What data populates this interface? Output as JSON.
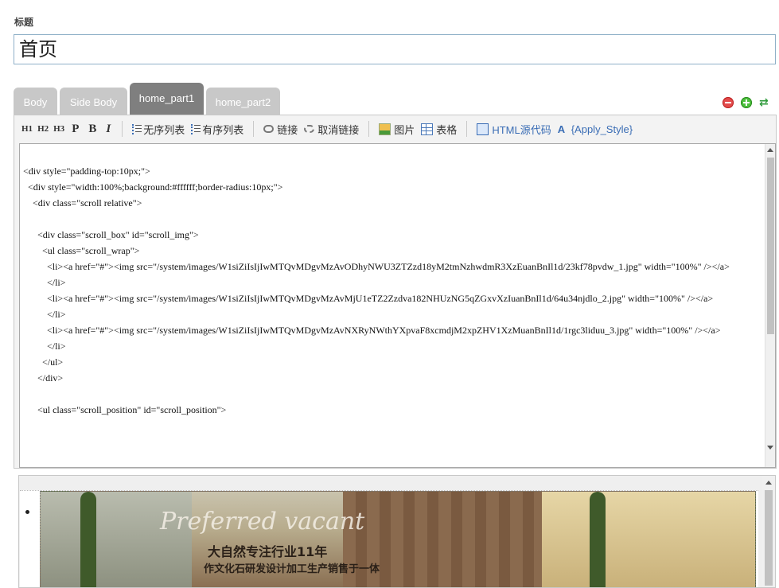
{
  "title_label": "标题",
  "title_value": "首页",
  "tabs": [
    {
      "label": "Body",
      "active": false
    },
    {
      "label": "Side Body",
      "active": false
    },
    {
      "label": "home_part1",
      "active": true
    },
    {
      "label": "home_part2",
      "active": false
    }
  ],
  "tab_tools": [
    "remove-icon",
    "add-icon",
    "shuffle-icon"
  ],
  "toolbar": {
    "h1": "H1",
    "h2": "H2",
    "h3": "H3",
    "p": "P",
    "b": "B",
    "i": "I",
    "unordered_list": "无序列表",
    "ordered_list": "有序列表",
    "link": "链接",
    "unlink": "取消链接",
    "image": "图片",
    "table": "表格",
    "html_source": "HTML源代码",
    "apply_style": "{Apply_Style}"
  },
  "code": "<div style=\"padding-top:10px;\">\n  <div style=\"width:100%;background:#ffffff;border-radius:10px;\">\n    <div class=\"scroll relative\">\n\n      <div class=\"scroll_box\" id=\"scroll_img\">\n        <ul class=\"scroll_wrap\">\n          <li><a href=\"#\"><img src=\"/system/images/W1siZiIsIjIwMTQvMDgvMzAvODhyNWU3ZTZzd18yM2tmNzhwdmR3XzEuanBnIl1d/23kf78pvdw_1.jpg\" width=\"100%\" /></a>\n          </li>\n          <li><a href=\"#\"><img src=\"/system/images/W1siZiIsIjIwMTQvMDgvMzAvMjU1eTZ2Zzdva182NHUzNG5qZGxvXzIuanBnIl1d/64u34njdlo_2.jpg\" width=\"100%\" /></a>\n          </li>\n          <li><a href=\"#\"><img src=\"/system/images/W1siZiIsIjIwMTQvMDgvMzAvNXRyNWthYXpvaF8xcmdjM2xpZHV1XzMuanBnIl1d/1rgc3liduu_3.jpg\" width=\"100%\" /></a>\n          </li>\n        </ul>\n      </div>\n\n      <ul class=\"scroll_position\" id=\"scroll_position\">",
  "preview": {
    "script_text": "Preferred vacant",
    "headline": "大自然专注行业11年",
    "subline": "作文化石研发设计加工生产销售于一体"
  }
}
